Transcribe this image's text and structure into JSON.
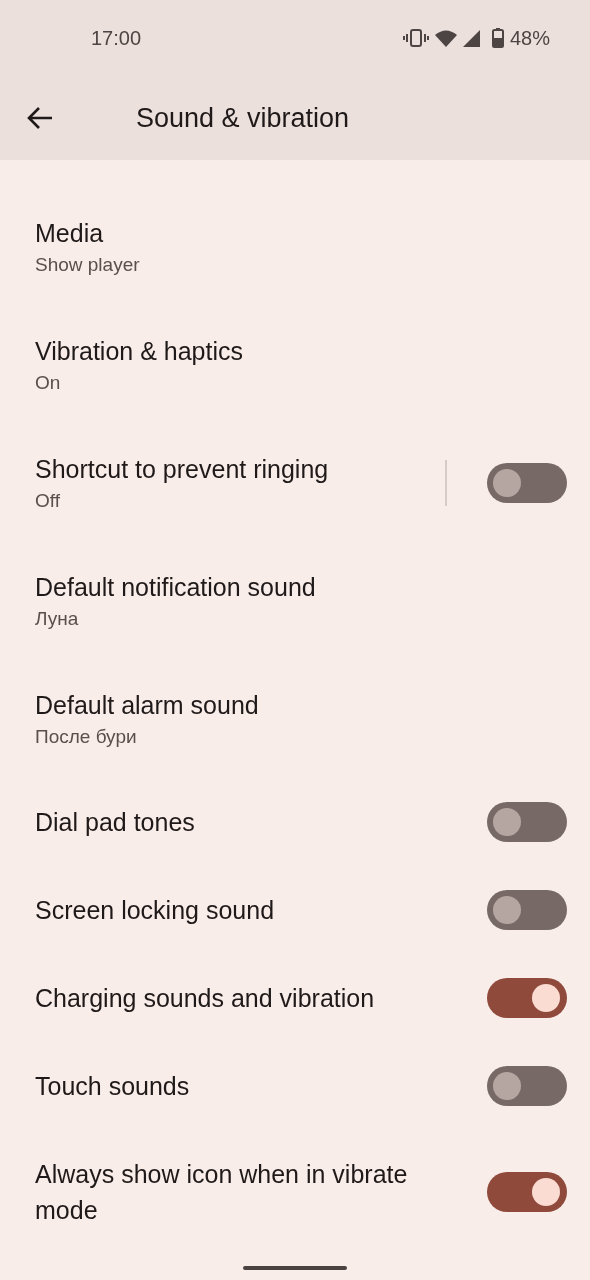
{
  "status_bar": {
    "time": "17:00",
    "battery": "48%"
  },
  "toolbar": {
    "title": "Sound & vibration"
  },
  "items": [
    {
      "kind": "link",
      "title": "Media",
      "subtitle": "Show player"
    },
    {
      "kind": "link",
      "title": "Vibration & haptics",
      "subtitle": "On"
    },
    {
      "kind": "split_toggle",
      "title": "Shortcut to prevent ringing",
      "subtitle": "Off",
      "on": false
    },
    {
      "kind": "link",
      "title": "Default notification sound",
      "subtitle": "Луна"
    },
    {
      "kind": "link",
      "title": "Default alarm sound",
      "subtitle": "После бури"
    },
    {
      "kind": "toggle",
      "title": "Dial pad tones",
      "on": false
    },
    {
      "kind": "toggle",
      "title": "Screen locking sound",
      "on": false
    },
    {
      "kind": "toggle",
      "title": "Charging sounds and vibration",
      "on": true
    },
    {
      "kind": "toggle",
      "title": "Touch sounds",
      "on": false
    },
    {
      "kind": "toggle",
      "title": "Always show icon when in vibrate mode",
      "on": true
    }
  ]
}
